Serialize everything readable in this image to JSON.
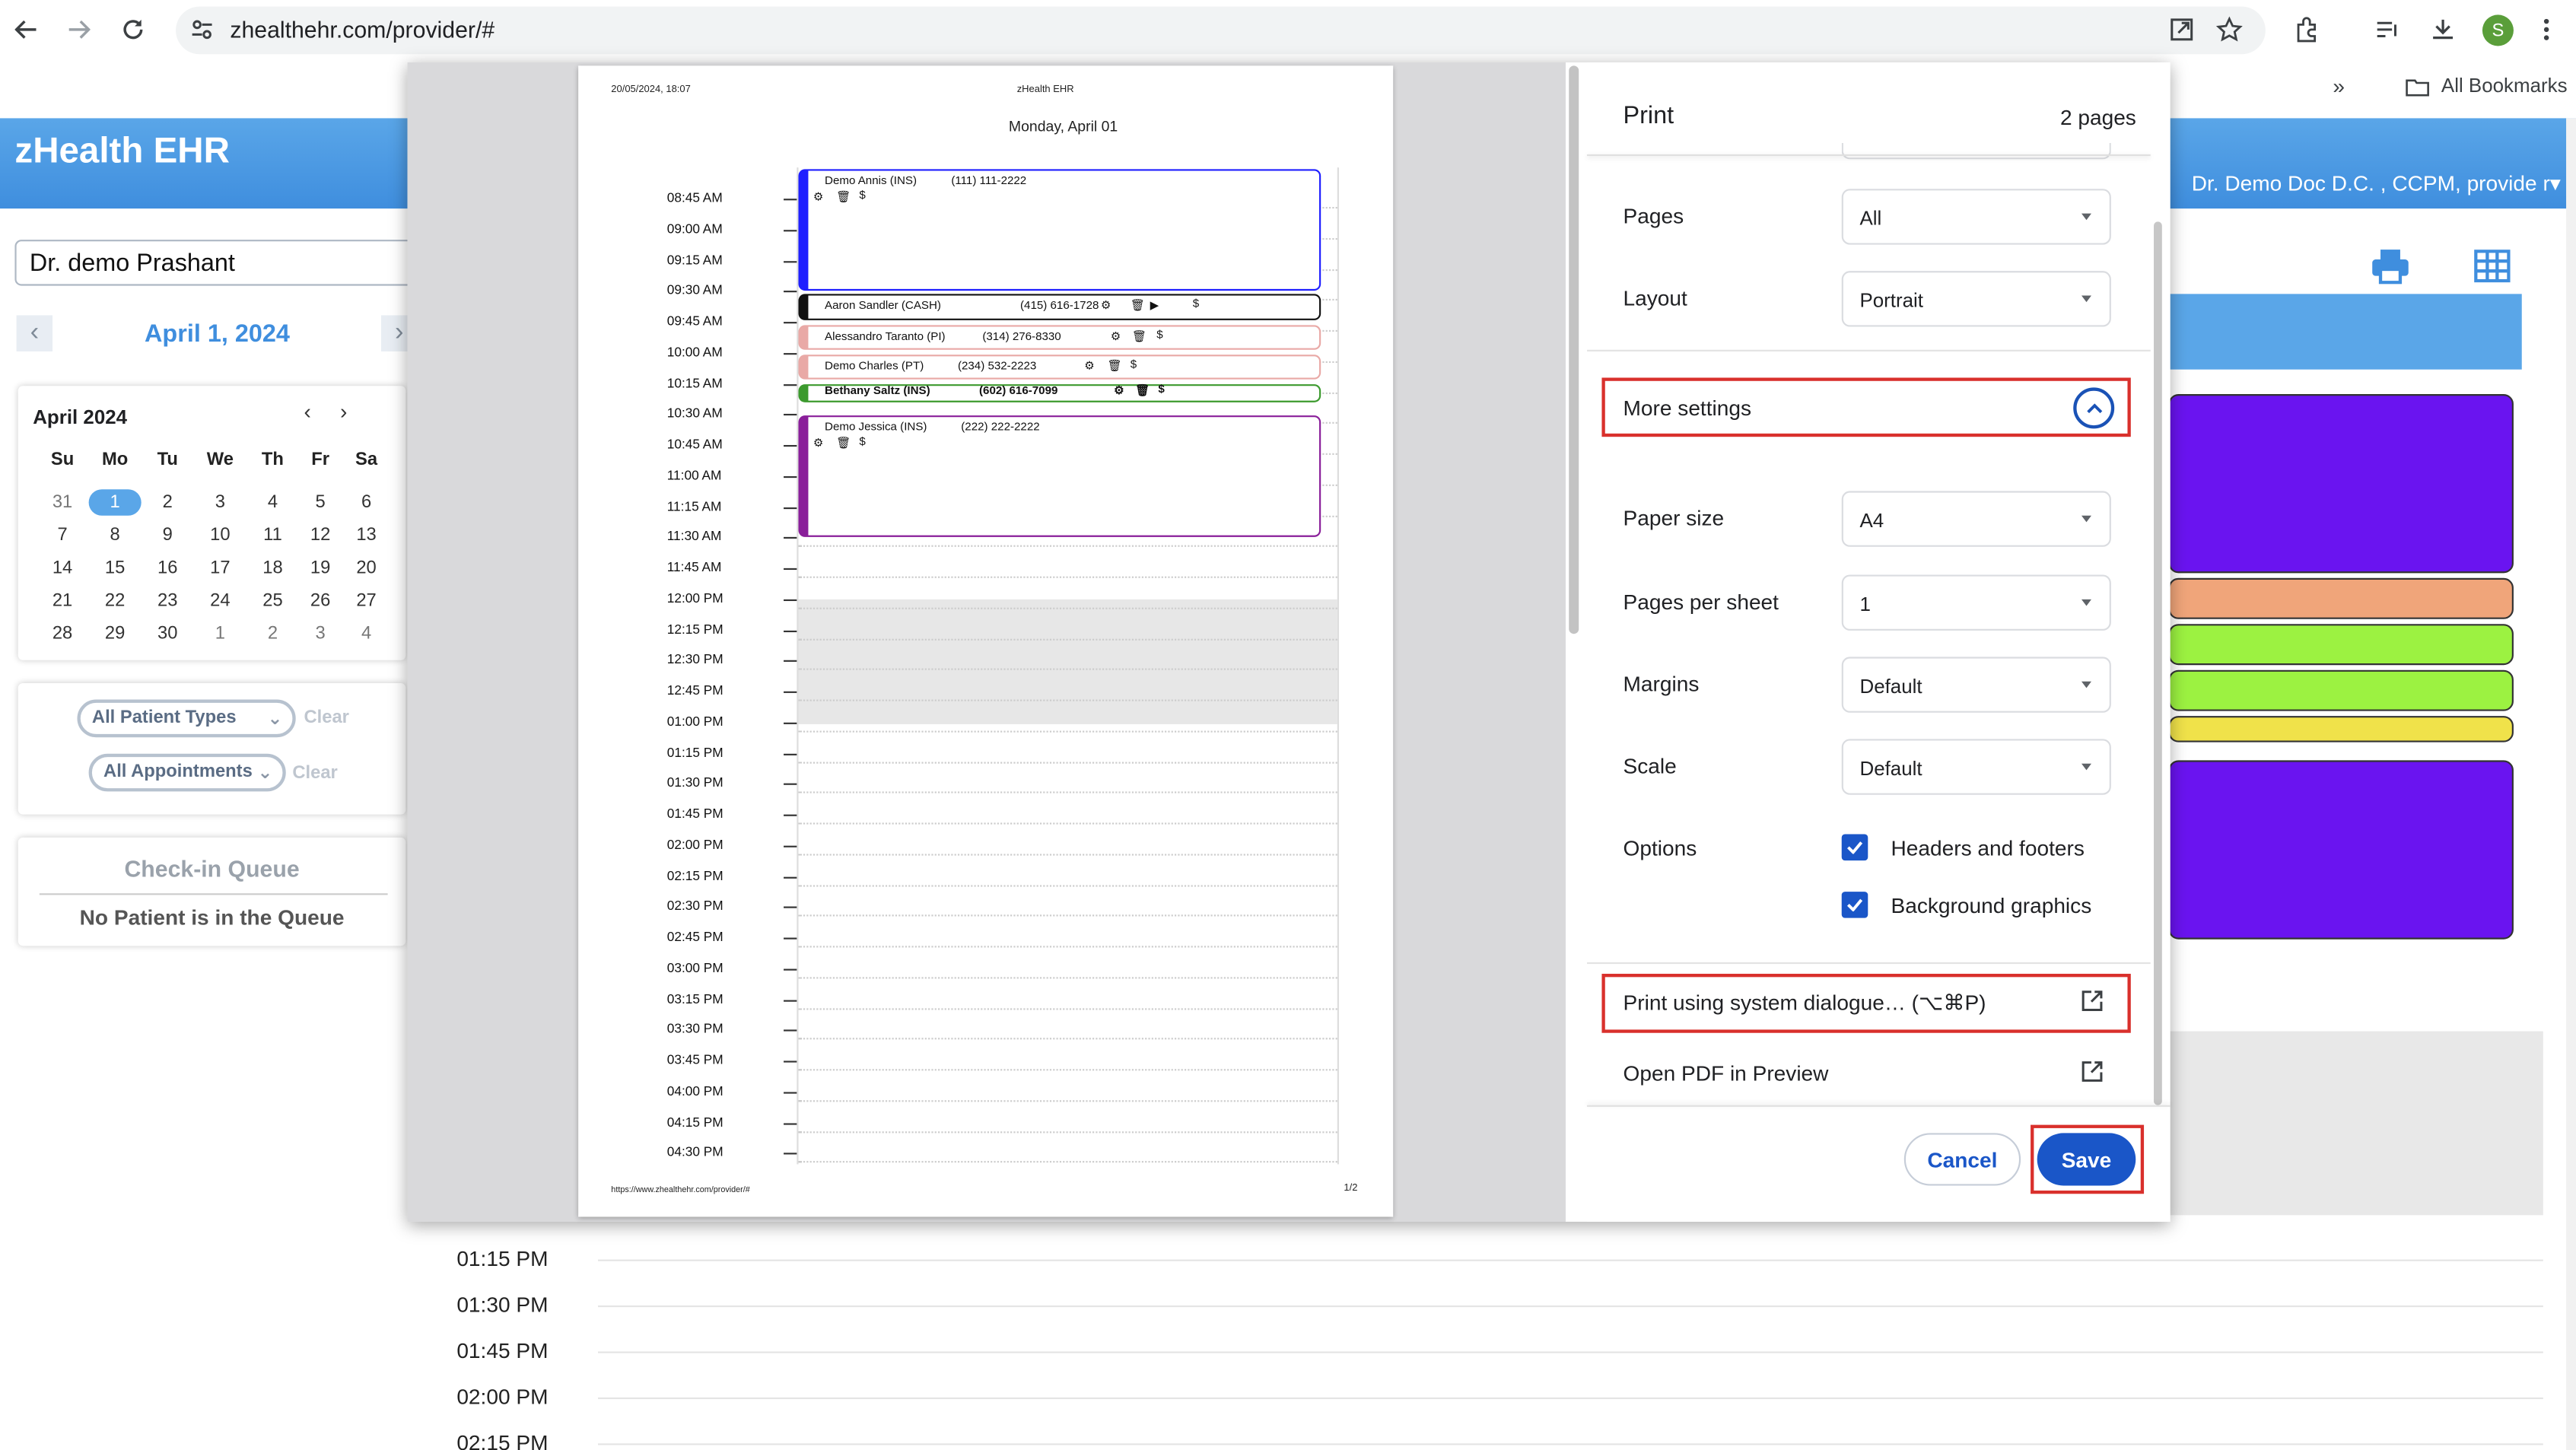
{
  "browser": {
    "url": "zhealthehr.com/provider/#",
    "all_bookmarks": "All Bookmarks",
    "profile_initial": "S"
  },
  "app": {
    "brand": "zHealth EHR",
    "user_menu": "Dr. Demo Doc D.C. , CCPM, provide r▾",
    "provider": "Dr. demo Prashant",
    "date_label": "April 1, 2024"
  },
  "calendar": {
    "title": "April 2024",
    "weekdays": [
      "Su",
      "Mo",
      "Tu",
      "We",
      "Th",
      "Fr",
      "Sa"
    ],
    "weeks": [
      [
        "31",
        "1",
        "2",
        "3",
        "4",
        "5",
        "6"
      ],
      [
        "7",
        "8",
        "9",
        "10",
        "11",
        "12",
        "13"
      ],
      [
        "14",
        "15",
        "16",
        "17",
        "18",
        "19",
        "20"
      ],
      [
        "21",
        "22",
        "23",
        "24",
        "25",
        "26",
        "27"
      ],
      [
        "28",
        "29",
        "30",
        "1",
        "2",
        "3",
        "4"
      ]
    ],
    "selected": "1"
  },
  "filters": {
    "patient_types": "All Patient Types",
    "appointments": "All Appointments",
    "clear": "Clear"
  },
  "queue": {
    "title": "Check-in Queue",
    "empty": "No Patient is in the Queue"
  },
  "background_times": [
    "01:15 PM",
    "01:30 PM",
    "01:45 PM",
    "02:00 PM",
    "02:15 PM"
  ],
  "right_appointment_colors": [
    "#6a14f0",
    "#f0a57a",
    "#9cf241",
    "#9cf241",
    "#f0e24a",
    "#6a14f0"
  ],
  "preview": {
    "header_left": "20/05/2024, 18:07",
    "header_center": "zHealth EHR",
    "date_title": "Monday, April 01",
    "footer_left": "https://www.zhealthehr.com/provider/#",
    "footer_right": "1/2",
    "times": [
      "08:45 AM",
      "09:00 AM",
      "09:15 AM",
      "09:30 AM",
      "09:45 AM",
      "10:00 AM",
      "10:15 AM",
      "10:30 AM",
      "10:45 AM",
      "11:00 AM",
      "11:15 AM",
      "11:30 AM",
      "11:45 AM",
      "12:00 PM",
      "12:15 PM",
      "12:30 PM",
      "12:45 PM",
      "01:00 PM",
      "01:15 PM",
      "01:30 PM",
      "01:45 PM",
      "02:00 PM",
      "02:15 PM",
      "02:30 PM",
      "02:45 PM",
      "03:00 PM",
      "03:15 PM",
      "03:30 PM",
      "03:45 PM",
      "04:00 PM",
      "04:15 PM",
      "04:30 PM"
    ],
    "appointments": [
      {
        "name": "Demo Annis (INS)",
        "phone": "(111) 111-2222",
        "color": "#1f1fff"
      },
      {
        "name": "Aaron Sandler (CASH)",
        "phone": "(415) 616-1728",
        "color": "#111111"
      },
      {
        "name": "Alessandro Taranto (PI)",
        "phone": "(314) 276-8330",
        "color": "#e9a9a6"
      },
      {
        "name": "Demo Charles (PT)",
        "phone": "(234) 532-2223",
        "color": "#e9a9a6"
      },
      {
        "name": "Bethany Saltz (INS)",
        "phone": "(602) 616-7099",
        "color": "#3c9a2e"
      },
      {
        "name": "Demo Jessica (INS)",
        "phone": "(222) 222-2222",
        "color": "#8a1f9a"
      }
    ]
  },
  "print": {
    "title": "Print",
    "page_count": "2 pages",
    "pages_label": "Pages",
    "pages_value": "All",
    "layout_label": "Layout",
    "layout_value": "Portrait",
    "more_settings": "More settings",
    "paper_size_label": "Paper size",
    "paper_size_value": "A4",
    "pps_label": "Pages per sheet",
    "pps_value": "1",
    "margins_label": "Margins",
    "margins_value": "Default",
    "scale_label": "Scale",
    "scale_value": "Default",
    "options_label": "Options",
    "opt_headers": "Headers and footers",
    "opt_background": "Background graphics",
    "system_dialog": "Print using system dialogue… (⌥⌘P)",
    "open_pdf": "Open PDF in Preview",
    "cancel": "Cancel",
    "save": "Save"
  }
}
